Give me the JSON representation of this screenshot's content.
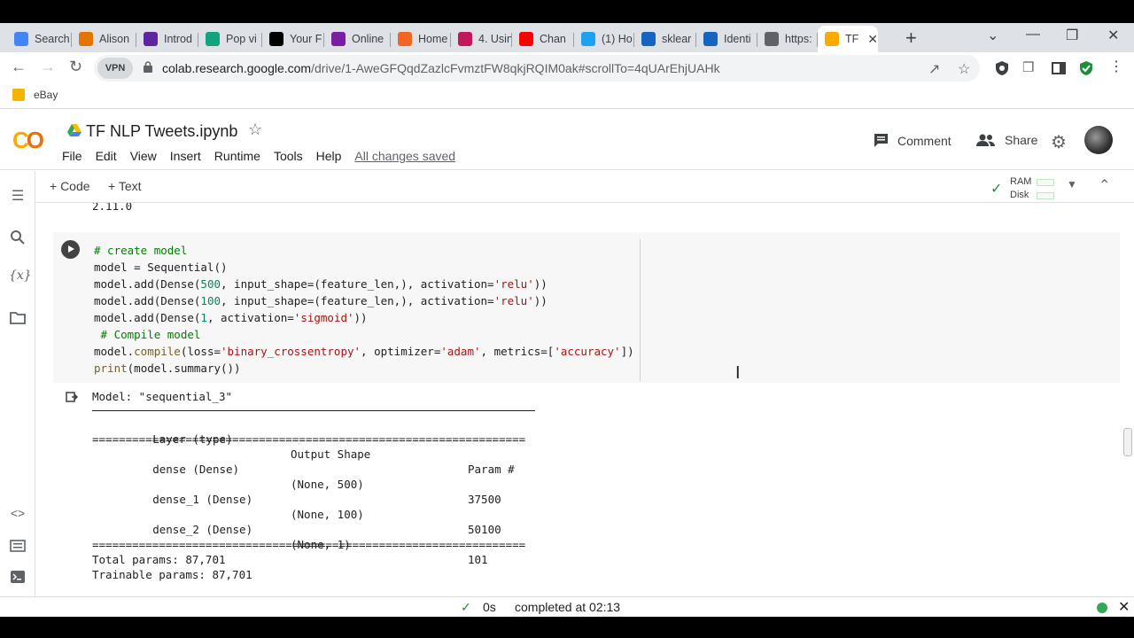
{
  "browser": {
    "tabs": [
      {
        "label": "Search",
        "icon": "google-icon",
        "color": "#4285f4"
      },
      {
        "label": "Alison",
        "icon": "alison-icon",
        "color": "#e37400"
      },
      {
        "label": "Introd",
        "icon": "introd-icon",
        "color": "#5f259f"
      },
      {
        "label": "Pop vi",
        "icon": "pop-icon",
        "color": "#10a37f"
      },
      {
        "label": "Your F",
        "icon": "medium-icon",
        "color": "#000000"
      },
      {
        "label": "Online",
        "icon": "online-icon",
        "color": "#7b1fa2"
      },
      {
        "label": "Home",
        "icon": "home-icon",
        "color": "#f26522"
      },
      {
        "label": "4. Usin",
        "icon": "opera-icon",
        "color": "#c2185b"
      },
      {
        "label": "Chan",
        "icon": "youtube-icon",
        "color": "#ff0000"
      },
      {
        "label": "(1) Ho",
        "icon": "twitter-icon",
        "color": "#1da1f2"
      },
      {
        "label": "sklear",
        "icon": "sklearn-icon",
        "color": "#1565c0"
      },
      {
        "label": "Identi",
        "icon": "k-icon",
        "color": "#1565c0"
      },
      {
        "label": "https:",
        "icon": "globe-icon",
        "color": "#5f6368"
      },
      {
        "label": "TF",
        "icon": "colab-icon",
        "color": "#f9ab00",
        "active": true
      }
    ],
    "address": {
      "vpn": "VPN",
      "url_host": "colab.research.google.com",
      "url_path": "/drive/1-AweGFQqdZazlcFvmztFW8qkjRQIM0ak#scrollTo=4qUArEhjUAHk"
    },
    "bookmarks": [
      {
        "label": "eBay"
      }
    ]
  },
  "colab": {
    "title": "TF NLP Tweets.ipynb",
    "menu": [
      "File",
      "Edit",
      "View",
      "Insert",
      "Runtime",
      "Tools",
      "Help"
    ],
    "saved_status": "All changes saved",
    "comment_label": "Comment",
    "share_label": "Share",
    "toolbar": {
      "code_label": "+ Code",
      "text_label": "+ Text",
      "ram_label": "RAM",
      "disk_label": "Disk"
    }
  },
  "cells": {
    "previous_output": "2.11.0",
    "code_lines": [
      "# create model",
      "model = Sequential()",
      "model.add(Dense(500, input_shape=(feature_len,), activation='relu'))",
      "model.add(Dense(100, input_shape=(feature_len,), activation='relu'))",
      "model.add(Dense(1, activation='sigmoid'))",
      " # Compile model",
      "model.compile(loss='binary_crossentropy', optimizer='adam', metrics=['accuracy'])",
      "print(model.summary())"
    ],
    "output": {
      "model_line": "Model: \"sequential_3\"",
      "headers": [
        "Layer (type)",
        "Output Shape",
        "Param #"
      ],
      "rows": [
        {
          "layer": "dense (Dense)",
          "shape": "(None, 500)",
          "params": "37500"
        },
        {
          "layer": "dense_1 (Dense)",
          "shape": "(None, 100)",
          "params": "50100"
        },
        {
          "layer": "dense_2 (Dense)",
          "shape": "(None, 1)",
          "params": "101"
        }
      ],
      "separator": "=================================================================",
      "total": "Total params: 87,701",
      "trainable": "Trainable params: 87,701"
    }
  },
  "status": {
    "time": "0s",
    "completed": "completed at 02:13"
  }
}
